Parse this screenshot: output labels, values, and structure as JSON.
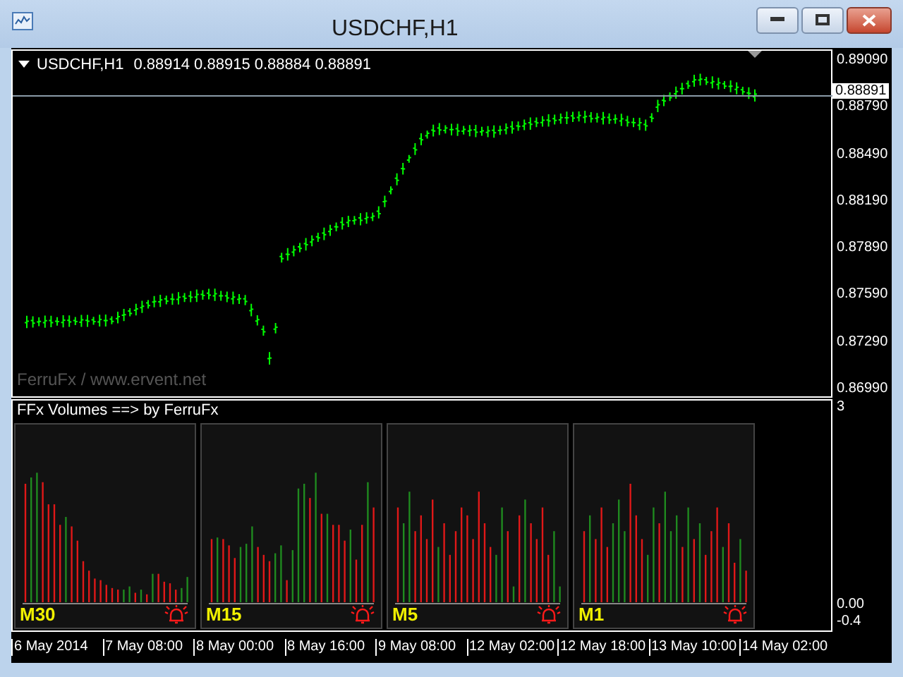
{
  "window": {
    "title": "USDCHF,H1"
  },
  "chart": {
    "symbol": "USDCHF,H1",
    "quote": "0.88914 0.88915 0.88884 0.88891",
    "watermark": "FerruFx / www.ervent.net",
    "current_price": "0.88891",
    "price_axis": [
      "0.89090",
      "0.88790",
      "0.88490",
      "0.88190",
      "0.87890",
      "0.87590",
      "0.87290",
      "0.86990"
    ]
  },
  "indicator": {
    "title": "FFx Volumes ==> by FerruFx",
    "scale": [
      "3",
      "0.00",
      "-0.4"
    ],
    "panels": [
      {
        "label": "M30"
      },
      {
        "label": "M15"
      },
      {
        "label": "M5"
      },
      {
        "label": "M1"
      }
    ]
  },
  "time_axis": [
    "6 May 2014",
    "7 May 08:00",
    "8 May 00:00",
    "8 May 16:00",
    "9 May 08:00",
    "12 May 02:00",
    "12 May 18:00",
    "13 May 10:00",
    "14 May 02:00"
  ]
}
